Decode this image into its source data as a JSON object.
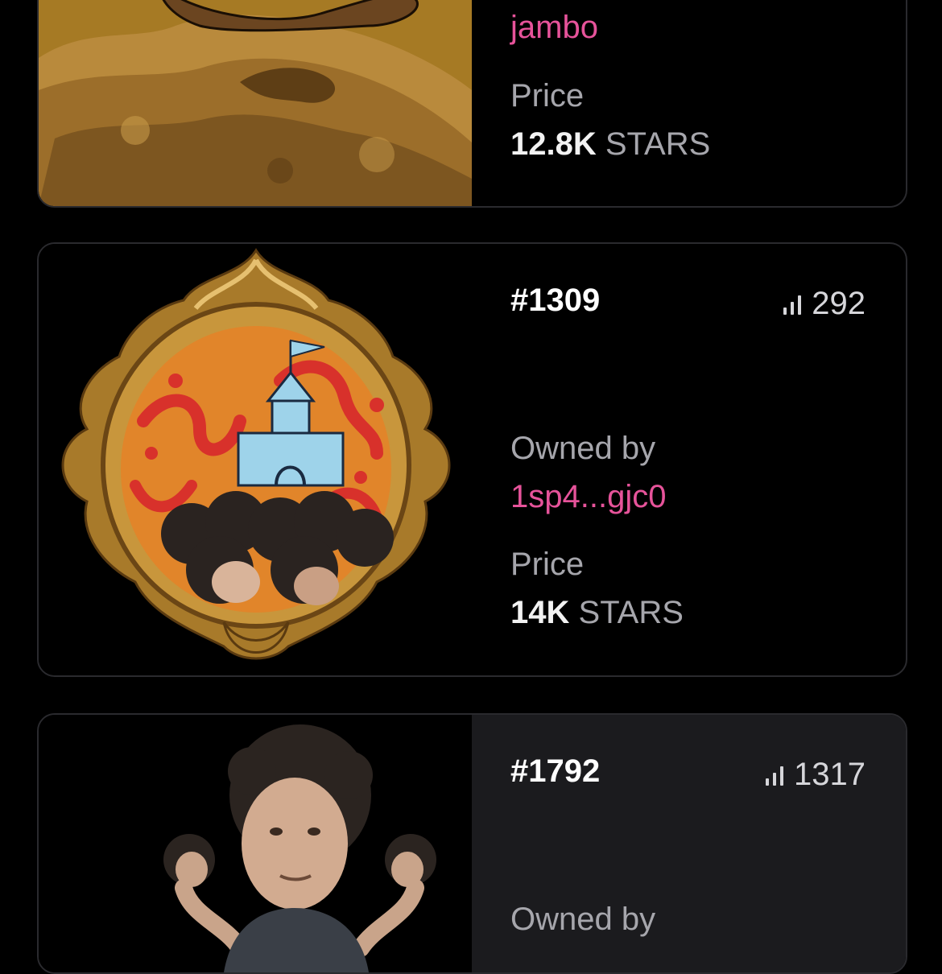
{
  "cards": [
    {
      "owner": "jambo",
      "price_label": "Price",
      "price_value": "12.8K",
      "price_unit": "STARS",
      "image": "meme-nft-image"
    },
    {
      "token_id": "#1309",
      "rank": "292",
      "owned_by_label": "Owned by",
      "owner": "1sp4...gjc0",
      "price_label": "Price",
      "price_value": "14K",
      "price_unit": "STARS",
      "image": "castle-mirror-nft-image"
    },
    {
      "token_id": "#1792",
      "rank": "1317",
      "owned_by_label": "Owned by",
      "image": "portrait-nft-image"
    }
  ],
  "colors": {
    "owner_link": "#e6539a",
    "label": "#a6a6ac",
    "card_border": "#2a2a2e",
    "highlight_card": "#1b1b1e"
  },
  "icons": [
    "rank-bars-icon"
  ]
}
